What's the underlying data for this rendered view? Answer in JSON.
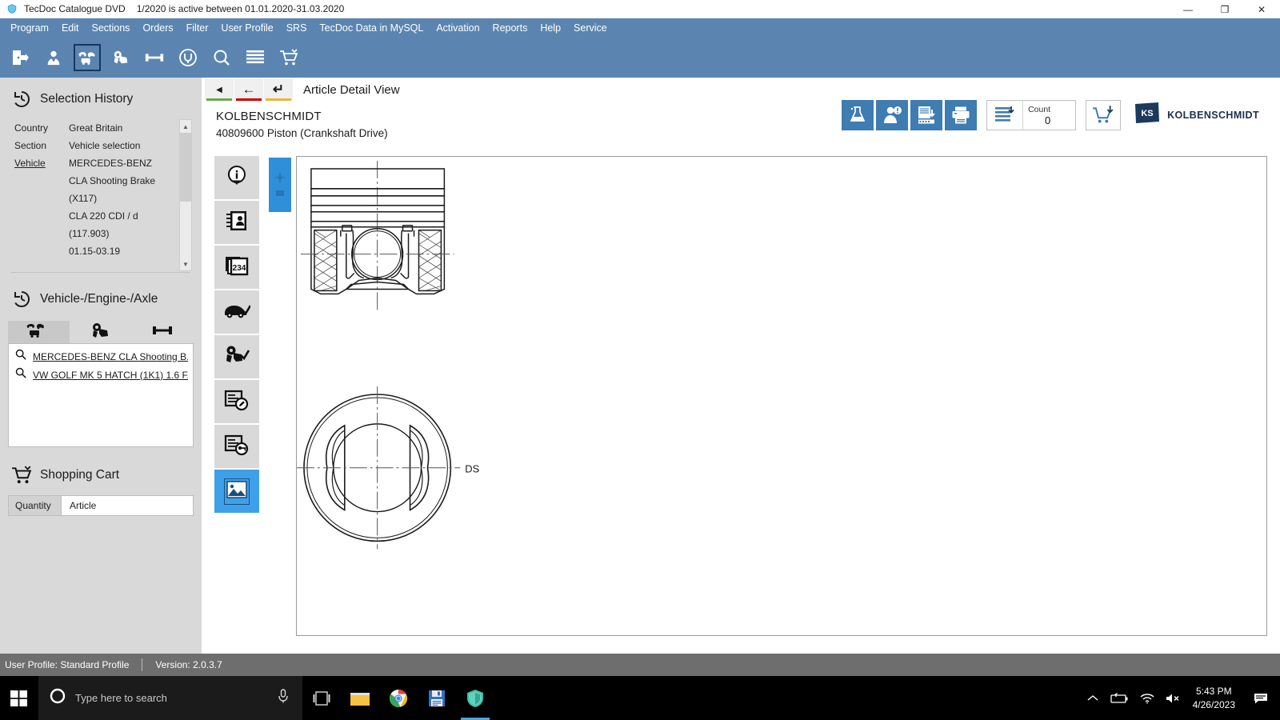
{
  "window": {
    "app_icon": "shield-icon",
    "title": "TecDoc Catalogue DVD",
    "subtitle": "1/2020 is active between 01.01.2020-31.03.2020",
    "minimize_label": "—",
    "restore_label": "❐",
    "close_label": "✕"
  },
  "menubar": {
    "items": [
      {
        "label": "Program"
      },
      {
        "label": "Edit"
      },
      {
        "label": "Sections"
      },
      {
        "label": "Orders"
      },
      {
        "label": "Filter"
      },
      {
        "label": "User Profile"
      },
      {
        "label": "SRS"
      },
      {
        "label": "TecDoc Data in MySQL"
      },
      {
        "label": "Activation"
      },
      {
        "label": "Reports"
      },
      {
        "label": "Help"
      },
      {
        "label": "Service"
      }
    ]
  },
  "toolbar": {
    "buttons": [
      {
        "icon": "exit-door-icon",
        "active": false
      },
      {
        "icon": "user-profile-icon",
        "active": false
      },
      {
        "icon": "vehicle-search-icon",
        "active": true
      },
      {
        "icon": "engine-search-icon",
        "active": false
      },
      {
        "icon": "axle-icon",
        "active": false
      },
      {
        "icon": "universal-parts-icon",
        "active": false
      },
      {
        "icon": "magnifier-icon",
        "active": false
      },
      {
        "icon": "list-lines-icon",
        "active": false
      },
      {
        "icon": "shopping-cart-icon",
        "active": false
      }
    ]
  },
  "sidebar": {
    "selection_history": {
      "icon": "history-clock-icon",
      "title": "Selection History",
      "rows": [
        {
          "key": "Country",
          "value": "Great Britain",
          "underlined": false
        },
        {
          "key": "Section",
          "value": "Vehicle selection",
          "underlined": false
        },
        {
          "key": "Vehicle",
          "value": "MERCEDES-BENZ",
          "underlined": true
        }
      ],
      "continuation": [
        "CLA Shooting Brake",
        "(X117)",
        "CLA 220 CDI / d",
        "(117.903)",
        "01.15-03.19"
      ],
      "scrollbar": {
        "up": "▲",
        "down": "▼"
      }
    },
    "vehicle_engine_axle": {
      "icon": "history-clock-icon",
      "title": "Vehicle-/Engine-/Axle",
      "tabs": [
        {
          "icon": "vehicle-types-icon",
          "selected": true
        },
        {
          "icon": "engine-icon",
          "selected": false
        },
        {
          "icon": "axle-icon",
          "selected": false
        }
      ],
      "items": [
        {
          "icon": "search-icon",
          "label": "MERCEDES-BENZ CLA Shooting B..."
        },
        {
          "icon": "search-icon",
          "label": "VW GOLF MK 5 HATCH (1K1) 1.6 F..."
        }
      ]
    },
    "shopping_cart": {
      "icon": "shopping-cart-icon",
      "title": "Shopping Cart",
      "columns": [
        "Quantity",
        "Article"
      ]
    }
  },
  "content": {
    "nav": {
      "back_small": "◀",
      "back": "←",
      "refresh": "↵",
      "back_small_color": "#6aa84f",
      "back_color": "#cc0000",
      "refresh_color": "#e8b53a",
      "title": "Article Detail View"
    },
    "article": {
      "brand": "KOLBENSCHMIDT",
      "description": "40809600 Piston (Crankshaft Drive)"
    },
    "header_tools": {
      "buttons": [
        {
          "icon": "chemical-flask-icon"
        },
        {
          "icon": "person-warning-icon"
        },
        {
          "icon": "document-download-icon"
        },
        {
          "icon": "printer-icon"
        }
      ],
      "count": {
        "icon": "list-add-icon",
        "label": "Count",
        "value": "0"
      },
      "cart_icon": "cart-add-icon",
      "brand_logo": "ks-logo-icon",
      "brand_name": "KOLBENSCHMIDT"
    },
    "vertical_tabs": [
      {
        "icon": "info-icon",
        "selected": false
      },
      {
        "icon": "contact-book-icon",
        "selected": false
      },
      {
        "icon": "pages-234-icon",
        "selected": false,
        "label": "234"
      },
      {
        "icon": "car-check-icon",
        "selected": false
      },
      {
        "icon": "engine-check-icon",
        "selected": false
      },
      {
        "icon": "document-edit-icon",
        "selected": false
      },
      {
        "icon": "document-key-icon",
        "selected": false
      },
      {
        "icon": "image-icon",
        "selected": true
      }
    ],
    "viewer": {
      "thumbnail_strip_icon": "image-thumbnail-icon",
      "drawing_label": "DS"
    }
  },
  "statusbar": {
    "user_profile": "User Profile: Standard Profile",
    "version": "Version: 2.0.3.7"
  },
  "taskbar": {
    "start_icon": "windows-start-icon",
    "search": {
      "icon": "cortana-circle-icon",
      "placeholder": "Type here to search",
      "mic_icon": "microphone-icon"
    },
    "apps": [
      {
        "icon": "task-view-icon",
        "active": false
      },
      {
        "icon": "file-explorer-icon",
        "active": false
      },
      {
        "icon": "chrome-icon",
        "active": false
      },
      {
        "icon": "floppy-save-icon",
        "active": false
      },
      {
        "icon": "tecdoc-shield-icon",
        "active": true
      }
    ],
    "tray": {
      "chevron_icon": "chevron-up-icon",
      "battery_icon": "battery-icon",
      "wifi_icon": "wifi-icon",
      "volume_icon": "volume-muted-icon",
      "time": "5:43 PM",
      "date": "4/26/2023",
      "notification_icon": "notification-icon"
    }
  }
}
